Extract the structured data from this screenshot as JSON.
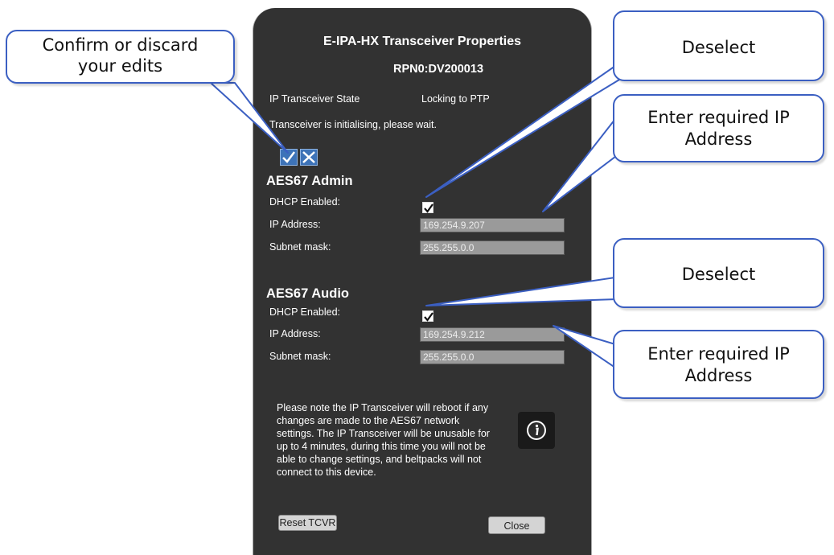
{
  "dialog": {
    "title": "E-IPA-HX Transceiver Properties",
    "subtitle": "RPN0:DV200013",
    "state_label": "IP Transceiver State",
    "state_value": "Locking to PTP",
    "status_message": "Transceiver is initialising, please wait.",
    "confirm_icon": "checkmark-icon",
    "discard_icon": "x-icon",
    "admin": {
      "heading": "AES67 Admin",
      "dhcp_label": "DHCP Enabled:",
      "dhcp_checked": true,
      "ip_label": "IP Address:",
      "ip_value": "169.254.9.207",
      "subnet_label": "Subnet mask:",
      "subnet_value": "255.255.0.0"
    },
    "audio": {
      "heading": "AES67 Audio",
      "dhcp_label": "DHCP Enabled:",
      "dhcp_checked": true,
      "ip_label": "IP Address:",
      "ip_value": "169.254.9.212",
      "subnet_label": "Subnet mask:",
      "subnet_value": "255.255.0.0"
    },
    "note": "Please note the IP Transceiver will reboot if any changes are made to the AES67 network settings. The IP Transceiver will be unusable for up to 4 minutes, during this time you will not be able to change settings, and beltpacks will not connect to this device.",
    "info_icon": "info-icon",
    "reset_label": "Reset TCVR",
    "close_label": "Close"
  },
  "callouts": {
    "confirm": {
      "line1": "Confirm or discard",
      "line2": "your edits"
    },
    "deselect_admin": {
      "line1": "Deselect"
    },
    "ip_admin": {
      "line1": "Enter required IP",
      "line2": "Address"
    },
    "deselect_audio": {
      "line1": "Deselect"
    },
    "ip_audio": {
      "line1": "Enter required IP",
      "line2": "Address"
    }
  },
  "colors": {
    "panel_bg": "#323232",
    "callout_border": "#3b5fc2",
    "icon_button": "#3d73b8"
  }
}
